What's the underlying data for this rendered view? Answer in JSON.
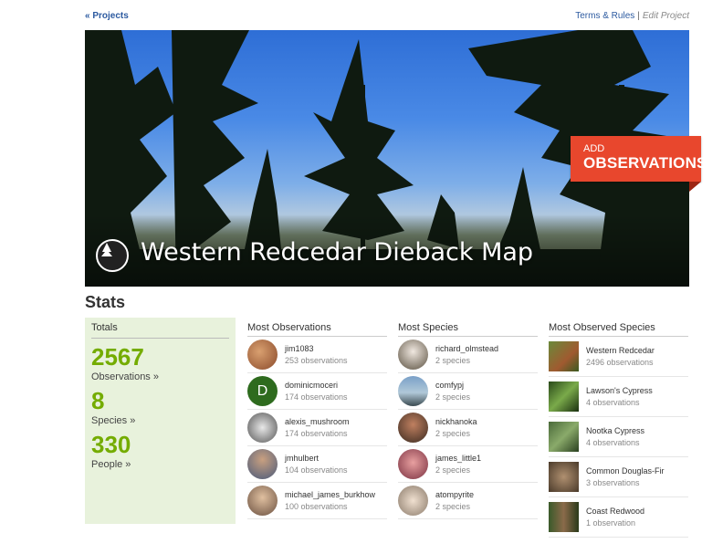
{
  "nav": {
    "back": "« Projects",
    "terms": "Terms & Rules",
    "sep": "|",
    "edit": "Edit Project"
  },
  "banner": {
    "title": "Western Redcedar Dieback Map"
  },
  "add_obs": {
    "line1": "ADD",
    "line2": "OBSERVATIONS"
  },
  "stats": {
    "heading": "Stats",
    "totals": {
      "header": "Totals",
      "observations": "2567",
      "observations_label": "Observations »",
      "species": "8",
      "species_label": "Species »",
      "people": "330",
      "people_label": "People »"
    },
    "most_observations": {
      "header": "Most Observations",
      "rows": [
        {
          "name": "jim1083",
          "count": "253 observations"
        },
        {
          "name": "dominicmoceri",
          "count": "174 observations",
          "initial": "D"
        },
        {
          "name": "alexis_mushroom",
          "count": "174 observations"
        },
        {
          "name": "jmhulbert",
          "count": "104 observations"
        },
        {
          "name": "michael_james_burkhow",
          "count": "100 observations"
        }
      ]
    },
    "most_species": {
      "header": "Most Species",
      "rows": [
        {
          "name": "richard_olmstead",
          "count": "2 species"
        },
        {
          "name": "comfypj",
          "count": "2 species"
        },
        {
          "name": "nickhanoka",
          "count": "2 species"
        },
        {
          "name": "james_little1",
          "count": "2 species"
        },
        {
          "name": "atompyrite",
          "count": "2 species"
        }
      ]
    },
    "most_observed_species": {
      "header": "Most Observed Species",
      "rows": [
        {
          "name": "Western Redcedar",
          "count": "2496 observations"
        },
        {
          "name": "Lawson's Cypress",
          "count": "4 observations"
        },
        {
          "name": "Nootka Cypress",
          "count": "4 observations"
        },
        {
          "name": "Common Douglas-Fir",
          "count": "3 observations"
        },
        {
          "name": "Coast Redwood",
          "count": "1 observation"
        }
      ]
    }
  },
  "colors": {
    "link": "#2c5aa0",
    "accent_green": "#74ac00",
    "add_button": "#e8472d",
    "totals_bg": "#e8f2dc"
  }
}
